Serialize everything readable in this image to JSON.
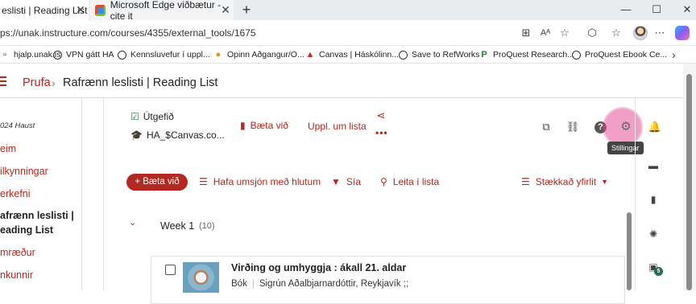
{
  "browser": {
    "tabs": [
      {
        "label": "eslisti | Reading List"
      },
      {
        "label": "Microsoft Edge viðbætur - cite it"
      }
    ],
    "url": "ps://unak.instructure.com/courses/4355/external_tools/1675",
    "bookmarks": [
      {
        "label": "hjalp.unak.is",
        "icon": "doc-icon"
      },
      {
        "label": "VPN gátt HA",
        "icon": "globe-icon"
      },
      {
        "label": "Kennsluvefur í uppl...",
        "icon": "globe-icon"
      },
      {
        "label": "Opinn Aðgangur/O...",
        "icon": "bulb-icon"
      },
      {
        "label": "Canvas | Háskólinn...",
        "icon": "canvas-icon"
      },
      {
        "label": "Save to RefWorks",
        "icon": "globe-icon"
      },
      {
        "label": "ProQuest Research...",
        "icon": "proquest-icon"
      },
      {
        "label": "ProQuest Ebook Ce...",
        "icon": "globe-icon"
      }
    ]
  },
  "canvas": {
    "breadcrumb": {
      "course": "Prufa",
      "page": "Rafrænn leslisti | Reading List"
    },
    "sidebar": {
      "term": "024 Haust",
      "items": [
        {
          "label": "eim"
        },
        {
          "label": "ilkynningar"
        },
        {
          "label": "erkefni"
        },
        {
          "label": "afrænn leslisti |"
        },
        {
          "label": "eading List"
        },
        {
          "label": "mræður"
        },
        {
          "label": "nkunnir"
        }
      ]
    },
    "toolbar": {
      "published": "Útgefið",
      "course_link": "HA_$Canvas.co...",
      "add": "Bæta við",
      "info": "Uppl. um lista",
      "tooltip": "Stillingar"
    },
    "actions": {
      "add_button": "+ Bæta við",
      "manage": "Hafa umsjón með hlutum",
      "filter": "Sía",
      "search": "Leita í lista",
      "view": "Stækkað yfirlit"
    },
    "week": {
      "label": "Week 1",
      "count": "(10)"
    },
    "item": {
      "title": "Virðing og umhyggja : ákall 21. aldar",
      "type": "Bók",
      "authors": "Sigrún Aðalbjarnardóttir, Reykjavík ;;"
    },
    "rail_badge": "5"
  },
  "colors": {
    "brand": "#b32821",
    "published_green": "#1f7f3c",
    "highlight": "#e8509b"
  }
}
